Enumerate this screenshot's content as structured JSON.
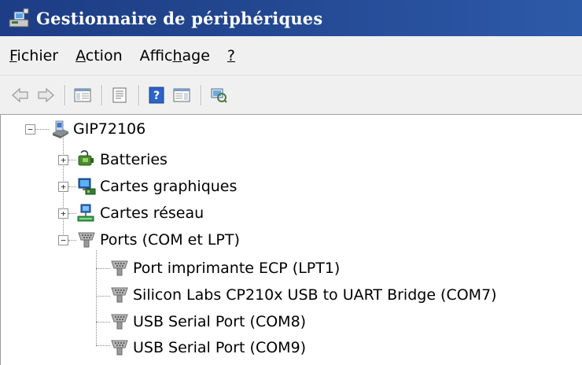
{
  "window": {
    "title": "Gestionnaire de périphériques"
  },
  "menu": [
    {
      "label": "Fichier",
      "accel": "F",
      "rest": "ichier"
    },
    {
      "label": "Action",
      "accel": "A",
      "rest": "ction"
    },
    {
      "label": "Affichage",
      "pre": "Affic",
      "accel": "h",
      "rest": "age"
    },
    {
      "label": "?",
      "accel": "?",
      "rest": ""
    }
  ],
  "toolbar": {
    "icons": [
      "back-arrow-icon",
      "forward-arrow-icon",
      "console-tree-icon",
      "properties-icon",
      "help-icon",
      "action-pane-icon",
      "scan-hardware-icon"
    ]
  },
  "tree": {
    "root": {
      "label": "GIP72106",
      "icon": "computer-icon",
      "expanded": true
    },
    "categories": [
      {
        "label": "Batteries",
        "icon": "battery-icon",
        "expanded": false
      },
      {
        "label": "Cartes graphiques",
        "icon": "display-adapter-icon",
        "expanded": false
      },
      {
        "label": "Cartes réseau",
        "icon": "network-adapter-icon",
        "expanded": false
      },
      {
        "label": "Ports (COM et LPT)",
        "icon": "port-icon",
        "expanded": true
      }
    ],
    "ports": [
      {
        "label": "Port imprimante ECP (LPT1)",
        "icon": "port-icon"
      },
      {
        "label": "Silicon Labs CP210x USB to UART Bridge (COM7)",
        "icon": "port-icon"
      },
      {
        "label": "USB Serial Port (COM8)",
        "icon": "port-icon"
      },
      {
        "label": "USB Serial Port (COM9)",
        "icon": "port-icon"
      }
    ]
  }
}
